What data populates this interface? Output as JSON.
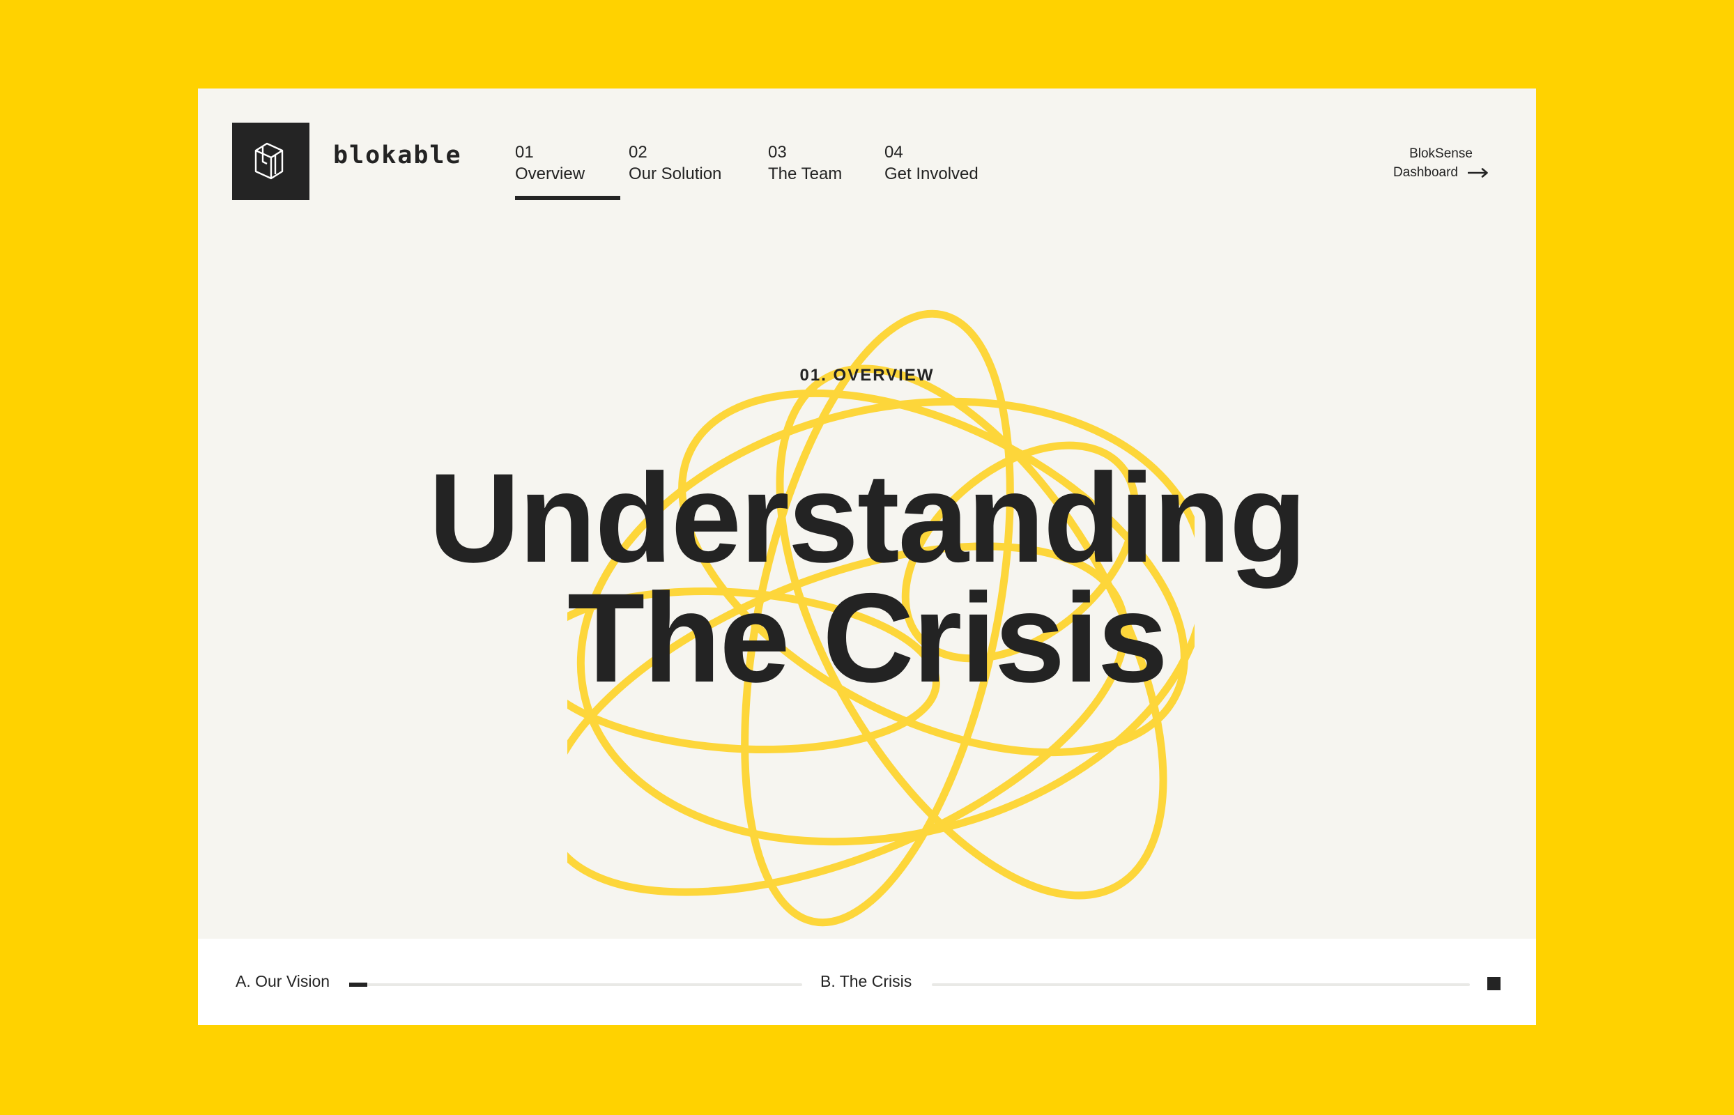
{
  "brand": {
    "name": "blokable"
  },
  "nav": {
    "items": [
      {
        "num": "01",
        "label": "Overview",
        "active": true
      },
      {
        "num": "02",
        "label": "Our Solution",
        "active": false
      },
      {
        "num": "03",
        "label": "The Team",
        "active": false
      },
      {
        "num": "04",
        "label": "Get Involved",
        "active": false
      }
    ]
  },
  "dashboard_link": {
    "line1": "BlokSense",
    "line2": "Dashboard"
  },
  "hero": {
    "eyebrow": "01. OVERVIEW",
    "title_line1": "Understanding",
    "title_line2": "The Crisis"
  },
  "footer": {
    "sections": [
      {
        "label": "A. Our Vision",
        "progress": 0.04
      },
      {
        "label": "B. The Crisis",
        "progress": 0
      }
    ]
  },
  "colors": {
    "background": "#FFD200",
    "panel": "#F6F5F0",
    "scribble": "#FDD63A",
    "ink": "#242424"
  },
  "icons": {
    "logo": "house-cube-icon",
    "dashboard_arrow": "arrow-right-icon",
    "stop": "stop-square-icon"
  }
}
